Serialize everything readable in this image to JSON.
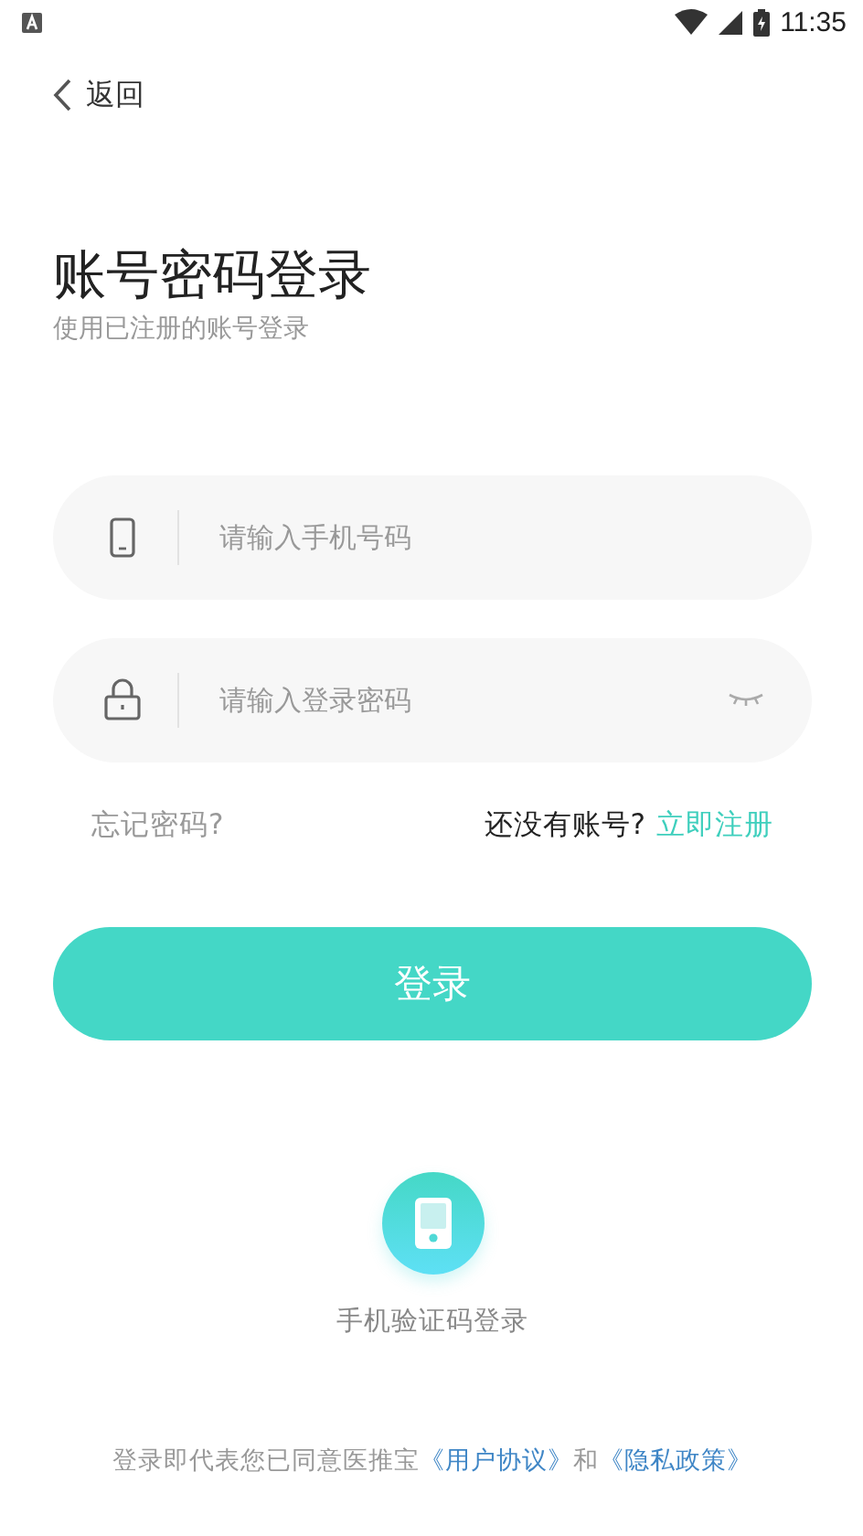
{
  "status_bar": {
    "time": "11:35"
  },
  "nav": {
    "back_label": "返回"
  },
  "heading": {
    "title": "账号密码登录",
    "subtitle": "使用已注册的账号登录"
  },
  "fields": [
    {
      "kind": "phone",
      "placeholder": "请输入手机号码"
    },
    {
      "kind": "password",
      "placeholder": "请输入登录密码"
    }
  ],
  "links": {
    "forgot": "忘记密码?",
    "no_account": "还没有账号?",
    "register": "立即注册"
  },
  "login_button": "登录",
  "alt_login": {
    "label": "手机验证码登录"
  },
  "agreement": {
    "text": "登录即代表您已同意医推宝",
    "links": [
      "《用户协议》",
      "《隐私政策》"
    ],
    "joiner": "和"
  }
}
